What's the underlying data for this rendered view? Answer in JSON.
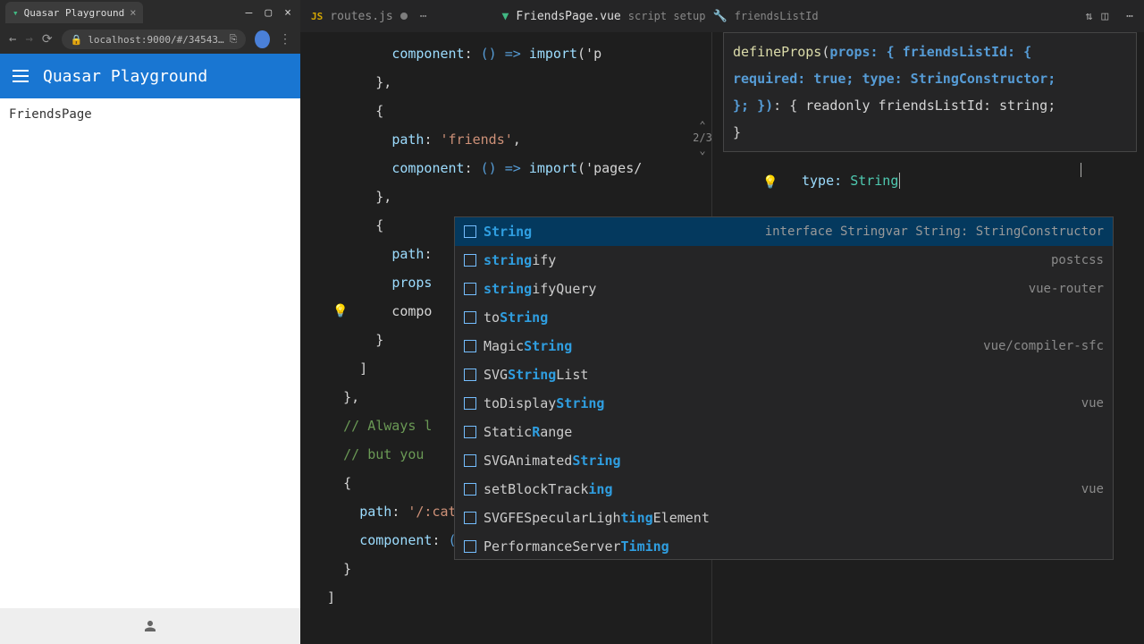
{
  "browser": {
    "tab_title": "Quasar Playground",
    "url_lock": "🔒",
    "url": "localhost:9000/#/34543…",
    "refresh": "⟳",
    "app_title": "Quasar Playground",
    "page_text": "FriendsPage"
  },
  "ide": {
    "left_tab": {
      "icon_color": "#e6b400",
      "name": "routes.js"
    },
    "right_tab": {
      "icon_color": "#41b883",
      "name": "FriendsPage.vue",
      "crumb1": "script setup",
      "crumb2": "friendsListId"
    },
    "signature": {
      "func": "defineProps",
      "param_label": "props: {",
      "line1_rest": " friendsListId: {",
      "line2": "required: true; type: StringConstructor;",
      "line3a": "}; })",
      "line3b": ": { readonly friendsListId: string;",
      "line4": "}",
      "counter": "2/3"
    },
    "typing_left": "type: ",
    "typing_val": "String",
    "code_left": [
      "          component: () => import('p",
      "        },",
      "        {",
      "          path: 'friends',",
      "          component: () => import('pages/",
      "        },",
      "        {",
      "          path:",
      "          props",
      "          compo",
      "        }",
      "      ]",
      "    },",
      "",
      "    // Always l",
      "    // but you ",
      "    {",
      "      path: '/:catchAll(.*)*',",
      "      component: () => import('pages/Err",
      "    }",
      "  ]"
    ],
    "suggestions": [
      {
        "pre": "",
        "match": "String",
        "post": "",
        "detail": "interface Stringvar String: StringConstructor",
        "sel": true
      },
      {
        "pre": "",
        "match": "string",
        "post": "ify",
        "detail": "postcss"
      },
      {
        "pre": "",
        "match": "string",
        "post": "ifyQuery",
        "detail": "vue-router"
      },
      {
        "pre": "to",
        "match": "String",
        "post": "",
        "detail": ""
      },
      {
        "pre": "Magic",
        "match": "String",
        "post": "",
        "detail": "vue/compiler-sfc"
      },
      {
        "pre": "SVG",
        "match": "String",
        "post": "List",
        "detail": ""
      },
      {
        "pre": "toDisplay",
        "match": "String",
        "post": "",
        "detail": "vue"
      },
      {
        "pre": "Static",
        "match": "R",
        "post": "ange",
        "detail": ""
      },
      {
        "pre": "SVGAnimated",
        "match": "String",
        "post": "",
        "detail": ""
      },
      {
        "pre": "setBlockTrack",
        "match": "ing",
        "post": "",
        "detail": "vue"
      },
      {
        "pre": "SVGFESpecularLigh",
        "match": "ting",
        "post": "Element",
        "detail": ""
      },
      {
        "pre": "PerformanceServer",
        "match": "Timing",
        "post": "",
        "detail": ""
      }
    ]
  }
}
